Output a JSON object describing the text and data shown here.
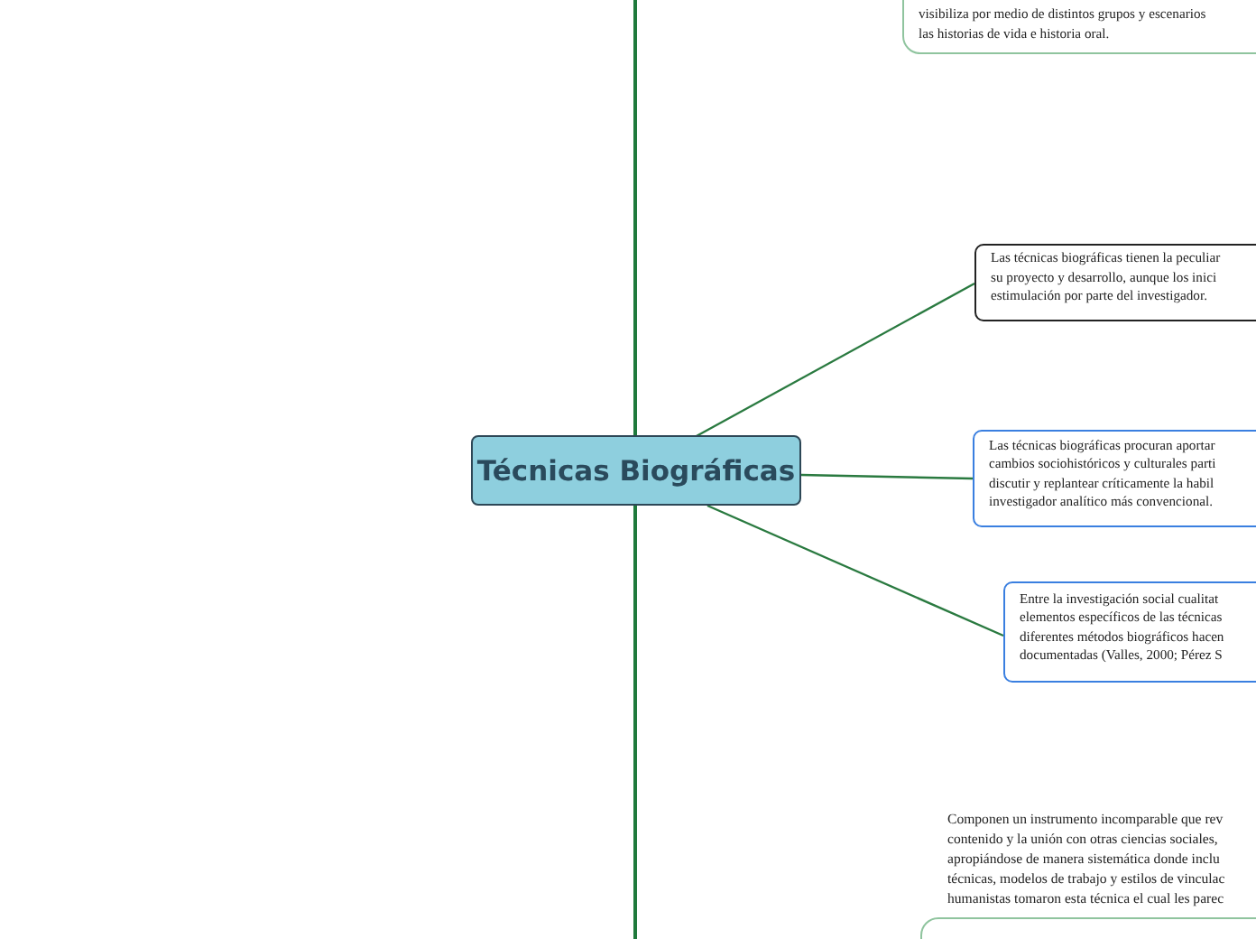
{
  "central_topic": {
    "title": "Técnicas Biográficas"
  },
  "branches": [
    {
      "kind": "green",
      "lines": [
        "visibiliza por medio de distintos grupos y escenarios",
        "las historias de vida e historia oral."
      ]
    },
    {
      "kind": "dark",
      "lines": [
        "Las técnicas biográficas tienen la peculiar",
        "su proyecto y desarrollo, aunque los inici",
        "estimulación por parte del investigador."
      ]
    },
    {
      "kind": "blue",
      "lines": [
        "Las técnicas biográficas procuran aportar",
        "cambios sociohistóricos y culturales parti",
        "discutir y replantear críticamente la habil",
        "investigador analítico más convencional."
      ]
    },
    {
      "kind": "blue",
      "lines": [
        "Entre la investigación social cualitat",
        "elementos específicos de las técnicas",
        "diferentes métodos biográficos hacen",
        "documentadas (Valles, 2000; Pérez S"
      ]
    },
    {
      "kind": "plain",
      "lines": [
        "Componen un instrumento incomparable que rev",
        "contenido y la unión con otras ciencias sociales,",
        "apropiándose de manera sistemática donde inclu",
        "técnicas, modelos de trabajo y estilos de vinculac",
        "humanistas tomaron esta técnica el cual les parec"
      ]
    }
  ]
}
